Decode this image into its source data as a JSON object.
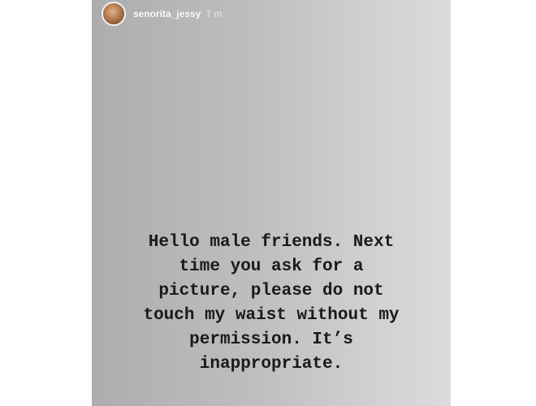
{
  "story": {
    "username": "senorita_jessy",
    "timestamp": "7 m",
    "avatar_icon": "profile-photo",
    "text_lines": [
      "Hello male friends. Next",
      "time you ask for a",
      "picture, please do not",
      "touch my waist without my",
      "permission. It’s",
      "inappropriate."
    ]
  }
}
